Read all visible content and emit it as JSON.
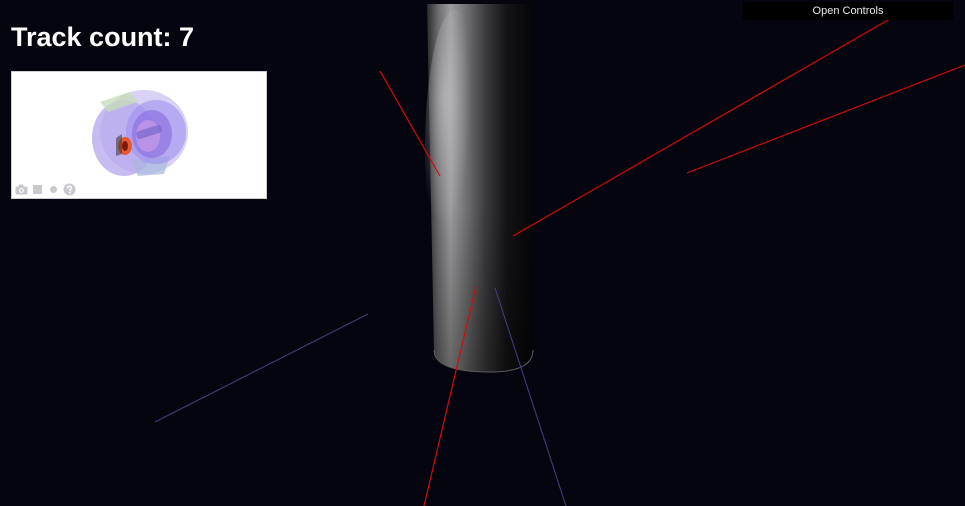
{
  "hud": {
    "track_count_label": "Track count: 7"
  },
  "controls": {
    "open_label": "Open Controls"
  },
  "thumbnail": {
    "toolbar": [
      {
        "icon": "camera-icon"
      },
      {
        "icon": "stop-icon"
      },
      {
        "icon": "record-icon"
      },
      {
        "icon": "help-icon"
      }
    ]
  },
  "scene": {
    "tracks": 7,
    "colors": {
      "background": "#05050f",
      "track_primary": "#d40a0a",
      "track_secondary": "#3b3f7a",
      "detector_cylinder": "#8a8a8a"
    }
  }
}
